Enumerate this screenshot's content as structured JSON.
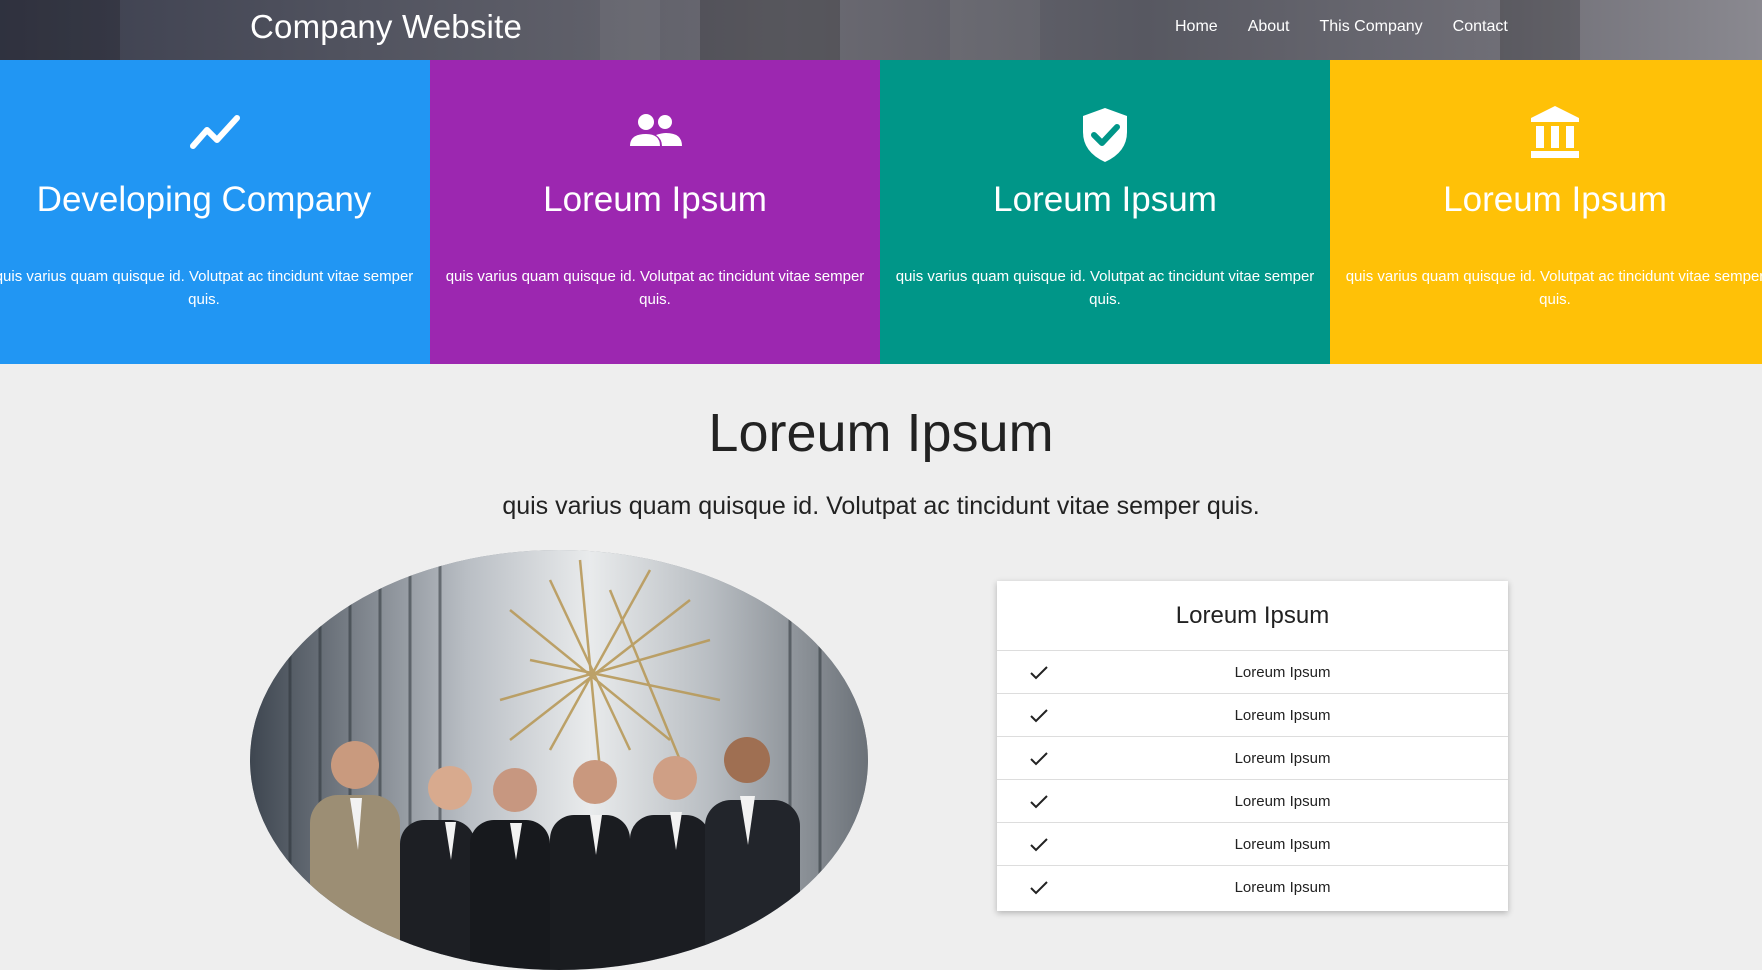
{
  "header": {
    "brand": "Company Website",
    "nav": [
      "Home",
      "About",
      "This Company",
      "Contact"
    ]
  },
  "features": [
    {
      "icon": "trending-up-icon",
      "title": "Developing Company",
      "text": "quis varius quam quisque id. Volutpat ac tincidunt vitae semper quis.",
      "color": "#2196f3"
    },
    {
      "icon": "people-icon",
      "title": "Loreum Ipsum",
      "text": "quis varius quam quisque id. Volutpat ac tincidunt vitae semper quis.",
      "color": "#9c27b0"
    },
    {
      "icon": "verified-shield-icon",
      "title": "Loreum Ipsum",
      "text": "quis varius quam quisque id. Volutpat ac tincidunt vitae semper quis.",
      "color": "#009688"
    },
    {
      "icon": "bank-icon",
      "title": "Loreum Ipsum",
      "text": "quis varius quam quisque id. Volutpat ac tincidunt vitae semper quis.",
      "color": "#ffc107"
    }
  ],
  "main": {
    "title": "Loreum Ipsum",
    "subtitle": "quis varius quam quisque id. Volutpat ac tincidunt vitae semper quis."
  },
  "list": {
    "title": "Loreum Ipsum",
    "items": [
      "Loreum Ipsum",
      "Loreum Ipsum",
      "Loreum Ipsum",
      "Loreum Ipsum",
      "Loreum Ipsum",
      "Loreum Ipsum"
    ]
  }
}
